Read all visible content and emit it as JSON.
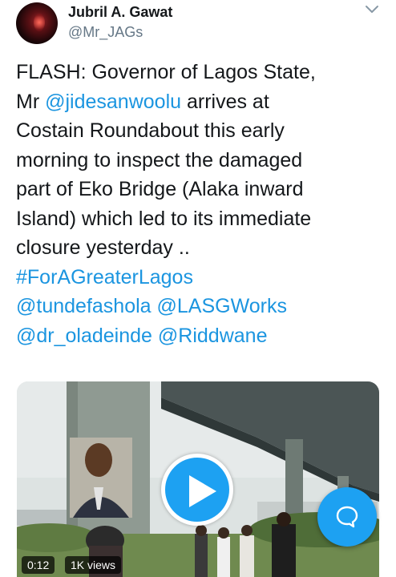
{
  "author": {
    "display_name": "Jubril A. Gawat",
    "handle": "@Mr_JAGs"
  },
  "icons": {
    "menu": "chevron-down-icon",
    "play": "play-icon",
    "compose": "speech-bubble-icon"
  },
  "tweet": {
    "lines": [
      [
        {
          "text": "FLASH: Governor of Lagos State,",
          "link": false
        }
      ],
      [
        {
          "text": "Mr ",
          "link": false
        },
        {
          "text": "@jidesanwoolu",
          "link": true
        },
        {
          "text": " arrives at",
          "link": false
        }
      ],
      [
        {
          "text": "Costain Roundabout this early",
          "link": false
        }
      ],
      [
        {
          "text": "morning to inspect the damaged",
          "link": false
        }
      ],
      [
        {
          "text": "part of Eko Bridge (Alaka inward",
          "link": false
        }
      ],
      [
        {
          "text": "Island) which led to its immediate",
          "link": false
        }
      ],
      [
        {
          "text": "closure yesterday ..",
          "link": false
        }
      ],
      [
        {
          "text": "#ForAGreaterLagos",
          "link": true
        }
      ],
      [
        {
          "text": "@tundefashola",
          "link": true
        },
        {
          "text": " ",
          "link": false
        },
        {
          "text": "@LASGWorks",
          "link": true
        }
      ],
      [
        {
          "text": "@dr_oladeinde",
          "link": true
        },
        {
          "text": " ",
          "link": false
        },
        {
          "text": "@Riddwane",
          "link": true
        }
      ]
    ]
  },
  "video": {
    "duration": "0:12",
    "views": "1K views"
  },
  "colors": {
    "link": "#1b95e0",
    "accent": "#1da1f2",
    "text": "#14171a",
    "secondary": "#657786"
  }
}
